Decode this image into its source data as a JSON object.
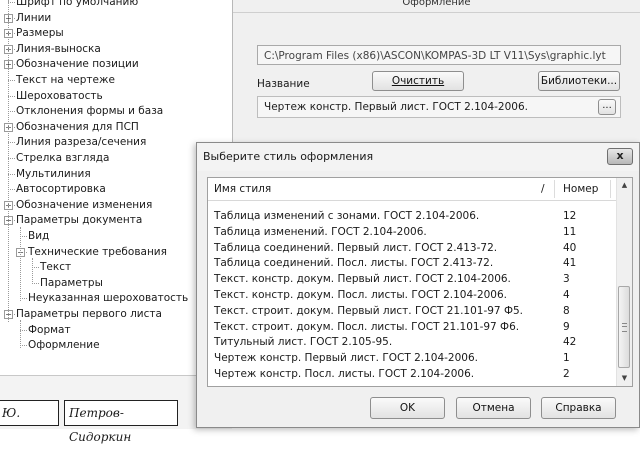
{
  "tree": {
    "items": [
      {
        "label": "Шрифт по умолчанию",
        "level": 0,
        "expander": "none"
      },
      {
        "label": "Линии",
        "level": 0,
        "expander": "+"
      },
      {
        "label": "Размеры",
        "level": 0,
        "expander": "+"
      },
      {
        "label": "Линия-выноска",
        "level": 0,
        "expander": "+"
      },
      {
        "label": "Обозначение позиции",
        "level": 0,
        "expander": "+"
      },
      {
        "label": "Текст на чертеже",
        "level": 0,
        "expander": "none"
      },
      {
        "label": "Шероховатость",
        "level": 0,
        "expander": "none"
      },
      {
        "label": "Отклонения формы и база",
        "level": 0,
        "expander": "none"
      },
      {
        "label": "Обозначения для ПСП",
        "level": 0,
        "expander": "+"
      },
      {
        "label": "Линия разреза/сечения",
        "level": 0,
        "expander": "none"
      },
      {
        "label": "Стрелка взгляда",
        "level": 0,
        "expander": "none"
      },
      {
        "label": "Мультилиния",
        "level": 0,
        "expander": "none"
      },
      {
        "label": "Автосортировка",
        "level": 0,
        "expander": "none"
      },
      {
        "label": "Обозначение изменения",
        "level": 0,
        "expander": "+"
      },
      {
        "label": "Параметры документа",
        "level": 0,
        "expander": "-"
      },
      {
        "label": "Вид",
        "level": 1,
        "expander": "none"
      },
      {
        "label": "Технические требования",
        "level": 1,
        "expander": "-"
      },
      {
        "label": "Текст",
        "level": 2,
        "expander": "none"
      },
      {
        "label": "Параметры",
        "level": 2,
        "expander": "none"
      },
      {
        "label": "Неуказанная шероховатость",
        "level": 1,
        "expander": "none"
      },
      {
        "label": "Параметры первого листа",
        "level": 0,
        "expander": "-"
      },
      {
        "label": "Формат",
        "level": 1,
        "expander": "none"
      },
      {
        "label": "Оформление",
        "level": 1,
        "expander": "none"
      }
    ]
  },
  "stamp": {
    "cell1": "Ю.",
    "cell2": "Петров-Сидоркин"
  },
  "panel": {
    "header": "Оформление",
    "path": "C:\\Program Files (x86)\\ASCON\\KOMPAS-3D LT V11\\Sys\\graphic.lyt",
    "name_label": "Название",
    "clear_button": "Очистить",
    "libraries_button": "Библиотеки...",
    "style_value": "Чертеж констр. Первый лист. ГОСТ 2.104-2006.",
    "browse_button": "..."
  },
  "dialog": {
    "title": "Выберите стиль оформления",
    "close_glyph": "x",
    "columns": {
      "name": "Имя стиля",
      "sort": "/",
      "number": "Номер"
    },
    "rows": [
      {
        "name": "Таблица изменений с зонами. ГОСТ 2.104-2006.",
        "number": "12"
      },
      {
        "name": "Таблица изменений. ГОСТ 2.104-2006.",
        "number": "11"
      },
      {
        "name": "Таблица соединений. Первый лист. ГОСТ 2.413-72.",
        "number": "40"
      },
      {
        "name": "Таблица соединений. Посл. листы. ГОСТ 2.413-72.",
        "number": "41"
      },
      {
        "name": "Текст. констр. докум. Первый лист. ГОСТ 2.104-2006.",
        "number": "3"
      },
      {
        "name": "Текст. констр. докум. Посл. листы. ГОСТ 2.104-2006.",
        "number": "4"
      },
      {
        "name": "Текст. строит. докум. Первый лист. ГОСТ 21.101-97 Ф5.",
        "number": "8"
      },
      {
        "name": "Текст. строит. докум. Посл. листы. ГОСТ 21.101-97 Ф6.",
        "number": "9"
      },
      {
        "name": "Титульный лист. ГОСТ 2.105-95.",
        "number": "42"
      },
      {
        "name": "Чертеж констр. Первый лист. ГОСТ 2.104-2006.",
        "number": "1"
      },
      {
        "name": "Чертеж констр. Посл. листы. ГОСТ 2.104-2006.",
        "number": "2"
      }
    ],
    "ok_button": "OK",
    "cancel_button": "Отмена",
    "help_button": "Справка"
  },
  "icons": {
    "scroll_up": "scroll-up-arrow-icon",
    "scroll_down": "scroll-down-arrow-icon",
    "close": "close-icon"
  }
}
